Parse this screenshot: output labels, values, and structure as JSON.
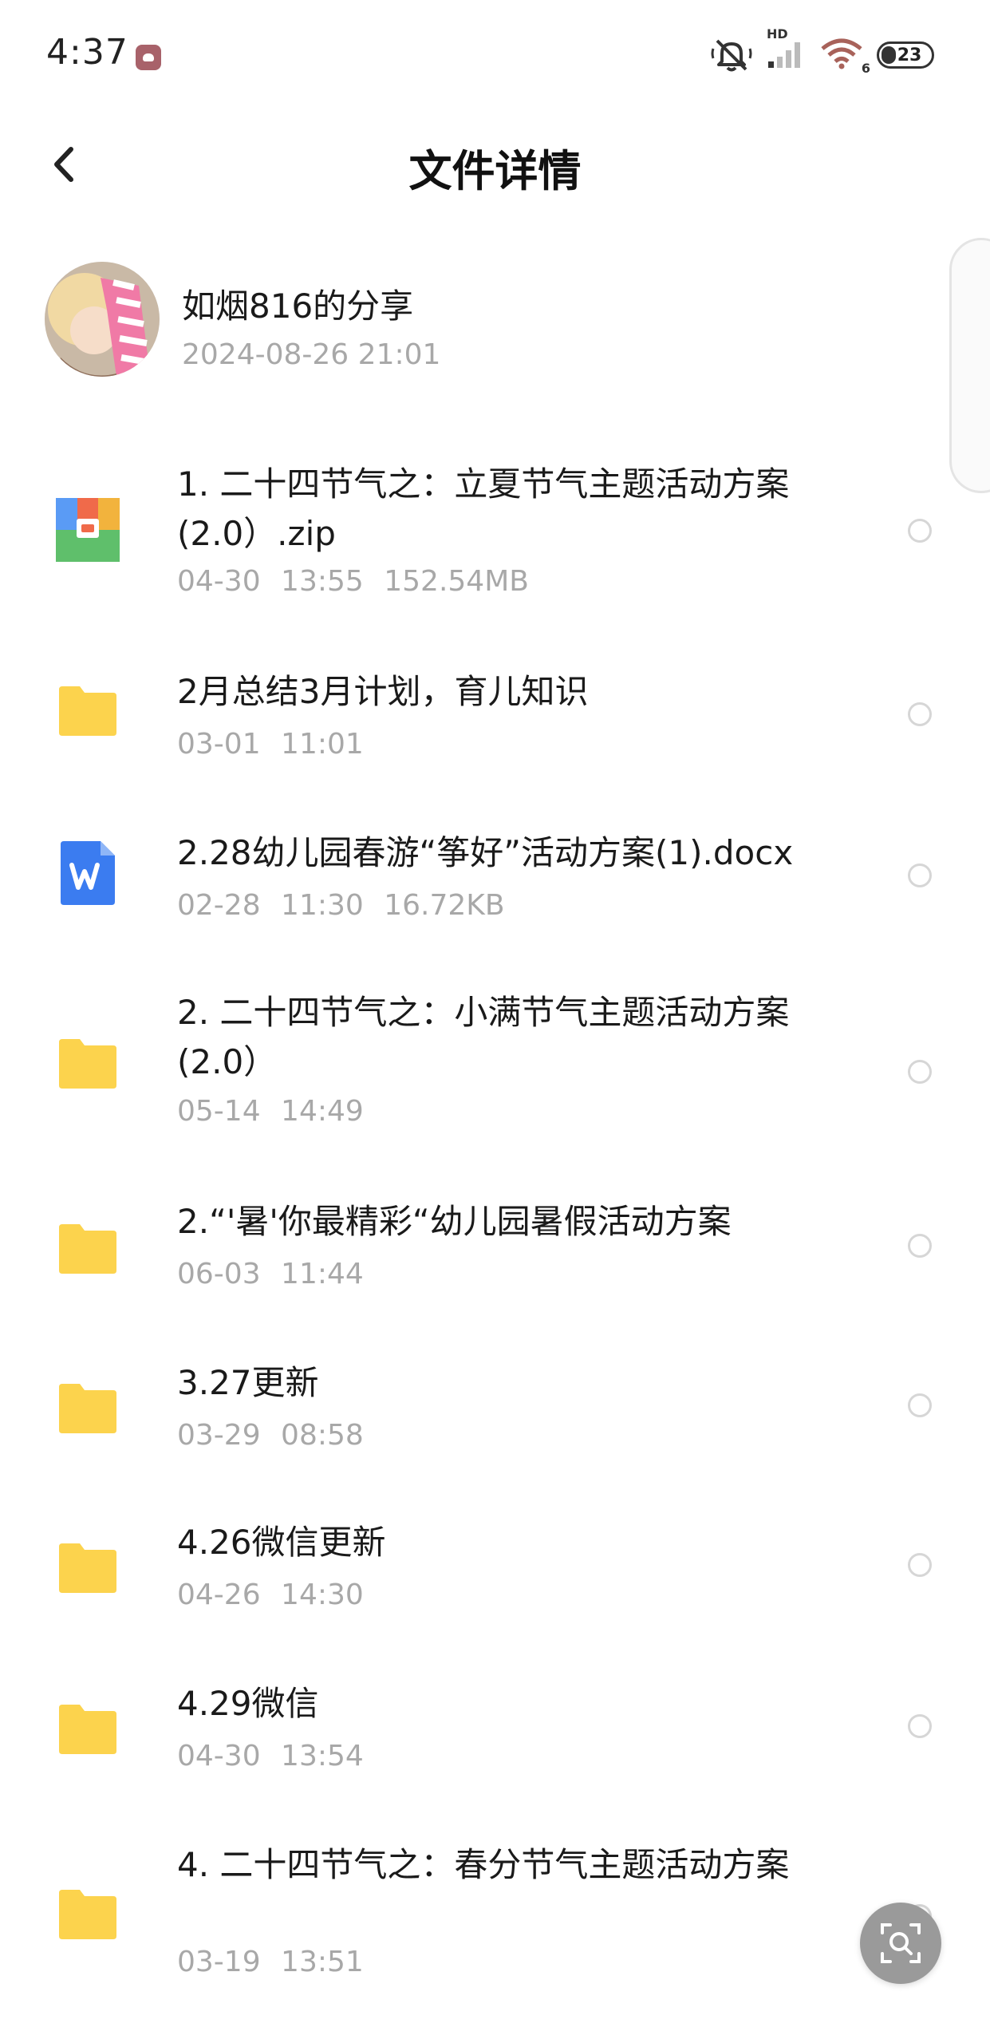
{
  "status_bar": {
    "time": "4:37",
    "hd_label": "HD",
    "wifi_sub": "6",
    "battery": "23",
    "icons": [
      "notification-app-icon",
      "mute-icon",
      "signal-icon",
      "wifi-icon",
      "battery-icon"
    ]
  },
  "header": {
    "title": "文件详情",
    "back_icon": "chevron-left-icon"
  },
  "share": {
    "title": "如烟816的分享",
    "date": "2024-08-26  21:01"
  },
  "files": [
    {
      "name": "1. 二十四节气之：立夏节气主题活动方案(2.0）.zip",
      "meta": "04-30  13:55  152.54MB",
      "icon": "zip-icon"
    },
    {
      "name": "2月总结3月计划，育儿知识",
      "meta": "03-01  11:01",
      "icon": "folder-icon"
    },
    {
      "name": "2.28幼儿园春游“筝好”活动方案(1).docx",
      "meta": "02-28  11:30  16.72KB",
      "icon": "word-doc-icon"
    },
    {
      "name": "2. 二十四节气之：小满节气主题活动方案(2.0）",
      "meta": "05-14  14:49",
      "icon": "folder-icon"
    },
    {
      "name": "2.“'暑'你最精彩“幼儿园暑假活动方案",
      "meta": "06-03  11:44",
      "icon": "folder-icon"
    },
    {
      "name": "3.27更新",
      "meta": "03-29  08:58",
      "icon": "folder-icon"
    },
    {
      "name": "4.26微信更新",
      "meta": "04-26  14:30",
      "icon": "folder-icon"
    },
    {
      "name": "4.29微信",
      "meta": "04-30  13:54",
      "icon": "folder-icon"
    },
    {
      "name": "4. 二十四节气之：春分节气主题活动方案",
      "meta": "03-19  13:51",
      "icon": "folder-icon"
    }
  ],
  "colors": {
    "folder": "#fcd34d",
    "meta_text": "#a8a8a8",
    "word_blue": "#3b7cf0",
    "float_button": "#9a9a9a"
  },
  "float_button": {
    "icon": "image-search-icon"
  }
}
